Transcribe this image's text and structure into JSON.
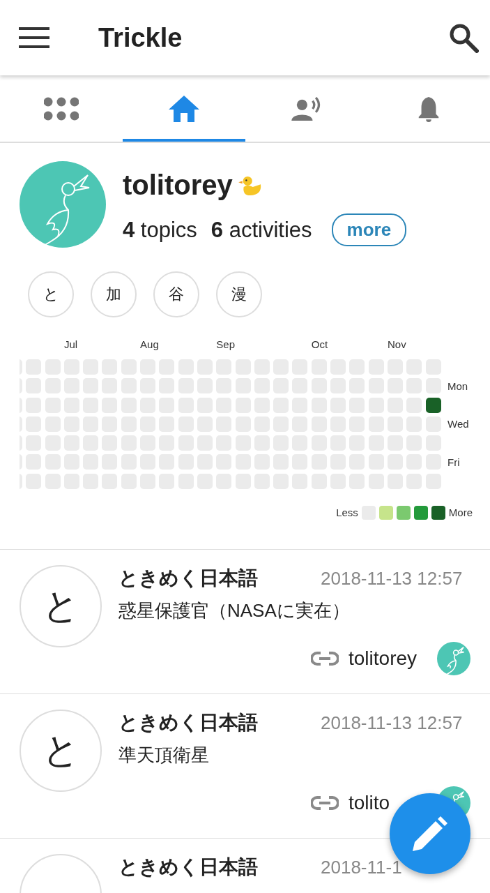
{
  "app_bar": {
    "title": "Trickle"
  },
  "tabs": [
    {
      "kind": "apps",
      "selected": false
    },
    {
      "kind": "home",
      "selected": true
    },
    {
      "kind": "speaking",
      "selected": false
    },
    {
      "kind": "bell",
      "selected": false
    }
  ],
  "profile": {
    "name": "tolitorey",
    "topics_count": "4",
    "topics_label": "topics",
    "activities_count": "6",
    "activities_label": "activities",
    "more_button": "more"
  },
  "topic_chips": [
    "と",
    "加",
    "谷",
    "漫"
  ],
  "heatmap": {
    "months": [
      "Jul",
      "Aug",
      "Sep",
      "Oct",
      "Nov"
    ],
    "rows": [
      {
        "cells": [
          {
            "active": false
          },
          {
            "active": false
          },
          {
            "active": false
          },
          {
            "active": false
          },
          {
            "active": false
          },
          {
            "active": false
          },
          {
            "active": false
          },
          {
            "active": false
          },
          {
            "active": false
          },
          {
            "active": false
          },
          {
            "active": false
          },
          {
            "active": false
          },
          {
            "active": false
          },
          {
            "active": false
          },
          {
            "active": false
          },
          {
            "active": false
          },
          {
            "active": false
          },
          {
            "active": false
          },
          {
            "active": false
          },
          {
            "active": false
          },
          {
            "active": false
          },
          {
            "active": false
          },
          {
            "active": false
          }
        ]
      },
      {
        "cells": [
          {
            "active": false
          },
          {
            "active": false
          },
          {
            "active": false
          },
          {
            "active": false
          },
          {
            "active": false
          },
          {
            "active": false
          },
          {
            "active": false
          },
          {
            "active": false
          },
          {
            "active": false
          },
          {
            "active": false
          },
          {
            "active": false
          },
          {
            "active": false
          },
          {
            "active": false
          },
          {
            "active": false
          },
          {
            "active": false
          },
          {
            "active": false
          },
          {
            "active": false
          },
          {
            "active": false
          },
          {
            "active": false
          },
          {
            "active": false
          },
          {
            "active": false
          },
          {
            "active": false
          },
          {
            "active": false
          }
        ]
      },
      {
        "cells": [
          {
            "active": false
          },
          {
            "active": false
          },
          {
            "active": false
          },
          {
            "active": false
          },
          {
            "active": false
          },
          {
            "active": false
          },
          {
            "active": false
          },
          {
            "active": false
          },
          {
            "active": false
          },
          {
            "active": false
          },
          {
            "active": false
          },
          {
            "active": false
          },
          {
            "active": false
          },
          {
            "active": false
          },
          {
            "active": false
          },
          {
            "active": false
          },
          {
            "active": false
          },
          {
            "active": false
          },
          {
            "active": false
          },
          {
            "active": false
          },
          {
            "active": false
          },
          {
            "active": false
          },
          {
            "active": true
          }
        ]
      },
      {
        "cells": [
          {
            "active": false
          },
          {
            "active": false
          },
          {
            "active": false
          },
          {
            "active": false
          },
          {
            "active": false
          },
          {
            "active": false
          },
          {
            "active": false
          },
          {
            "active": false
          },
          {
            "active": false
          },
          {
            "active": false
          },
          {
            "active": false
          },
          {
            "active": false
          },
          {
            "active": false
          },
          {
            "active": false
          },
          {
            "active": false
          },
          {
            "active": false
          },
          {
            "active": false
          },
          {
            "active": false
          },
          {
            "active": false
          },
          {
            "active": false
          },
          {
            "active": false
          },
          {
            "active": false
          },
          {
            "active": false
          }
        ]
      },
      {
        "cells": [
          {
            "active": false
          },
          {
            "active": false
          },
          {
            "active": false
          },
          {
            "active": false
          },
          {
            "active": false
          },
          {
            "active": false
          },
          {
            "active": false
          },
          {
            "active": false
          },
          {
            "active": false
          },
          {
            "active": false
          },
          {
            "active": false
          },
          {
            "active": false
          },
          {
            "active": false
          },
          {
            "active": false
          },
          {
            "active": false
          },
          {
            "active": false
          },
          {
            "active": false
          },
          {
            "active": false
          },
          {
            "active": false
          },
          {
            "active": false
          },
          {
            "active": false
          },
          {
            "active": false
          },
          {
            "active": false
          }
        ]
      },
      {
        "cells": [
          {
            "active": false
          },
          {
            "active": false
          },
          {
            "active": false
          },
          {
            "active": false
          },
          {
            "active": false
          },
          {
            "active": false
          },
          {
            "active": false
          },
          {
            "active": false
          },
          {
            "active": false
          },
          {
            "active": false
          },
          {
            "active": false
          },
          {
            "active": false
          },
          {
            "active": false
          },
          {
            "active": false
          },
          {
            "active": false
          },
          {
            "active": false
          },
          {
            "active": false
          },
          {
            "active": false
          },
          {
            "active": false
          },
          {
            "active": false
          },
          {
            "active": false
          },
          {
            "active": false
          },
          {
            "active": false
          }
        ]
      },
      {
        "cells": [
          {
            "active": false
          },
          {
            "active": false
          },
          {
            "active": false
          },
          {
            "active": false
          },
          {
            "active": false
          },
          {
            "active": false
          },
          {
            "active": false
          },
          {
            "active": false
          },
          {
            "active": false
          },
          {
            "active": false
          },
          {
            "active": false
          },
          {
            "active": false
          },
          {
            "active": false
          },
          {
            "active": false
          },
          {
            "active": false
          },
          {
            "active": false
          },
          {
            "active": false
          },
          {
            "active": false
          },
          {
            "active": false
          },
          {
            "active": false
          },
          {
            "active": false
          },
          {
            "active": false
          },
          {
            "active": false
          }
        ]
      }
    ],
    "day_labels": [
      "Mon",
      "Wed",
      "Fri"
    ],
    "legend": {
      "less": "Less",
      "more": "More",
      "swatches": [
        {
          "color": "#ebebeb"
        },
        {
          "color": "#c6e48b"
        },
        {
          "color": "#7bc96f"
        },
        {
          "color": "#239a3b"
        },
        {
          "color": "#196127"
        }
      ]
    }
  },
  "posts": [
    {
      "avatar_char": "と",
      "topic": "ときめく日本語",
      "time": "2018-11-13 12:57",
      "text": "惑星保護官（NASAに実在）",
      "author": "tolitorey"
    },
    {
      "avatar_char": "と",
      "topic": "ときめく日本語",
      "time": "2018-11-13 12:57",
      "text": "準天頂衛星",
      "author": "tolito"
    },
    {
      "topic": "ときめく日本語",
      "time": "2018-11-1"
    }
  ]
}
